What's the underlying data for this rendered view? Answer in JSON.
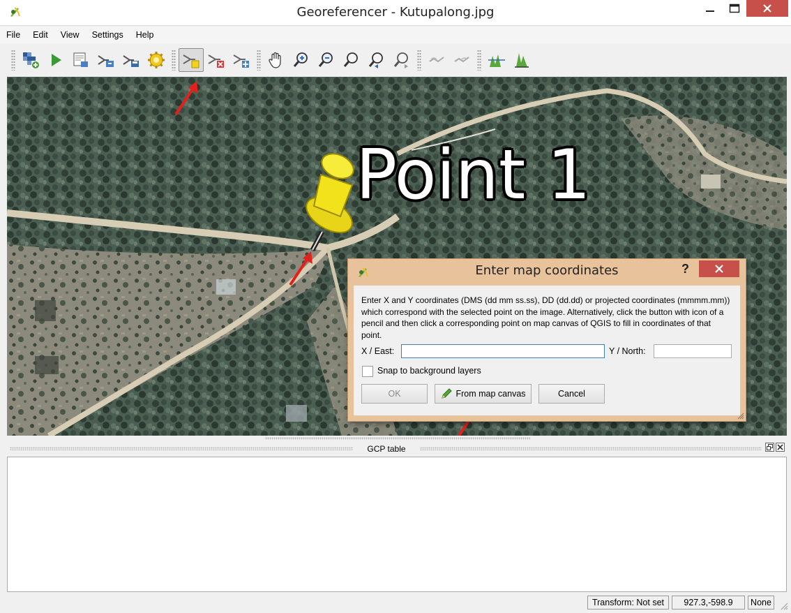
{
  "window": {
    "title": "Georeferencer - Kutupalong.jpg"
  },
  "menu": [
    "File",
    "Edit",
    "View",
    "Settings",
    "Help"
  ],
  "toolbar": {
    "buttons": [
      {
        "name": "open-raster-button",
        "icon": "open-raster-icon"
      },
      {
        "name": "start-georeferencing-button",
        "icon": "play-icon"
      },
      {
        "name": "generate-gdal-script-button",
        "icon": "gdal-script-icon"
      },
      {
        "name": "load-gcp-points-button",
        "icon": "load-gcp-icon"
      },
      {
        "name": "save-gcp-points-button",
        "icon": "save-gcp-icon"
      },
      {
        "name": "transformation-settings-button",
        "icon": "gear-icon"
      },
      {
        "name": "add-point-button",
        "icon": "add-point-icon",
        "active": true
      },
      {
        "name": "delete-point-button",
        "icon": "delete-point-icon"
      },
      {
        "name": "move-gcp-point-button",
        "icon": "move-point-icon"
      },
      {
        "name": "pan-button",
        "icon": "hand-icon"
      },
      {
        "name": "zoom-in-button",
        "icon": "zoom-in-icon"
      },
      {
        "name": "zoom-out-button",
        "icon": "zoom-out-icon"
      },
      {
        "name": "zoom-to-layer-button",
        "icon": "zoom-layer-icon"
      },
      {
        "name": "zoom-last-button",
        "icon": "zoom-last-icon"
      },
      {
        "name": "zoom-next-button",
        "icon": "zoom-next-icon"
      },
      {
        "name": "link-georeferencer-button",
        "icon": "link-georef-icon"
      },
      {
        "name": "link-qgis-button",
        "icon": "link-qgis-icon"
      },
      {
        "name": "full-histogram-stretch-button",
        "icon": "histogram-stretch-icon"
      },
      {
        "name": "local-histogram-stretch-button",
        "icon": "histogram-local-icon"
      }
    ]
  },
  "canvas": {
    "point_label": "Point 1"
  },
  "dialog": {
    "title": "Enter map coordinates",
    "help": "?",
    "description": "Enter X and Y coordinates (DMS (dd mm ss.ss), DD (dd.dd) or projected coordinates (mmmm.mm)) which correspond with the selected point on the image. Alternatively, click the button with icon of a pencil and then click a corresponding point on map canvas of QGIS to fill in coordinates of that point.",
    "x_label": "X / East:",
    "x_value": "",
    "y_label": "Y / North:",
    "y_value": "",
    "snap_label": "Snap to background layers",
    "snap_checked": false,
    "ok_label": "OK",
    "from_map_label": "From map canvas",
    "cancel_label": "Cancel"
  },
  "gcp_panel": {
    "title": "GCP table"
  },
  "status": {
    "transform": "Transform: Not set",
    "coords": "927.3,-598.9",
    "crs": "None"
  },
  "colors": {
    "close_red": "#c7504b",
    "dialog_frame": "#e8c29a",
    "arrow_red": "#e3211c",
    "pin_yellow": "#f2e21c"
  }
}
